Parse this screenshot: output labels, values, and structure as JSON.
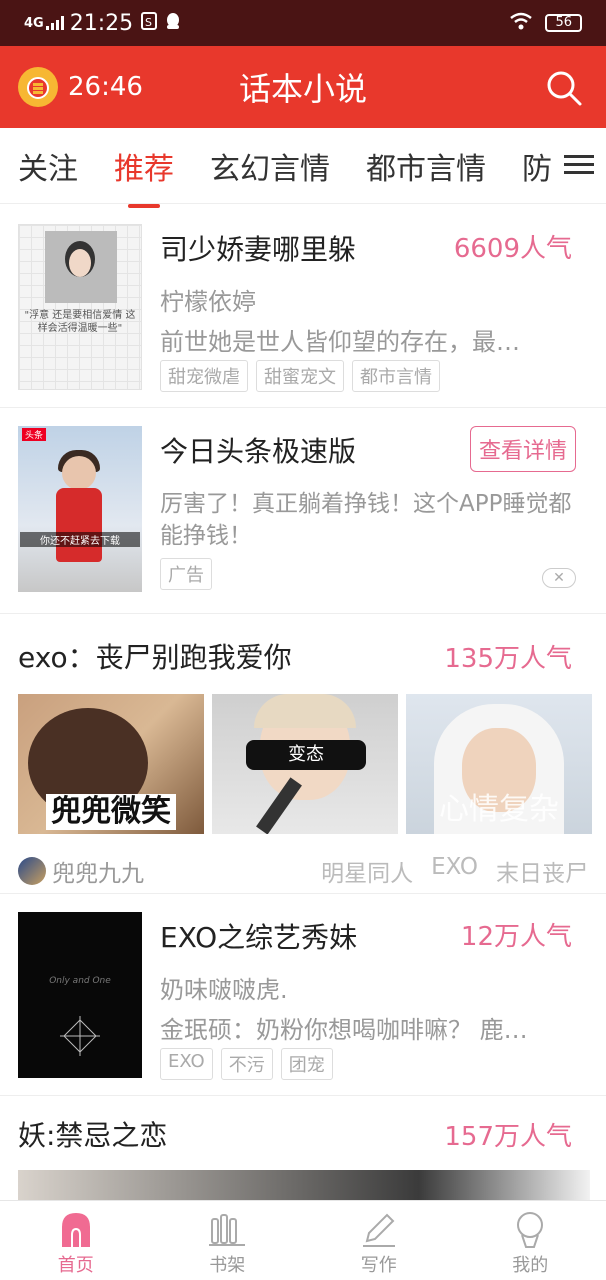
{
  "status_bar": {
    "network": "4G",
    "time": "21:25",
    "battery": "56"
  },
  "app_bar": {
    "timer": "26:46",
    "title": "话本小说"
  },
  "tabs": [
    {
      "label": "关注",
      "active": false
    },
    {
      "label": "推荐",
      "active": true
    },
    {
      "label": "玄幻言情",
      "active": false
    },
    {
      "label": "都市言情",
      "active": false
    },
    {
      "label": "防",
      "active": false
    }
  ],
  "feed": {
    "book1": {
      "title": "司少娇妻哪里躲",
      "popularity": "6609人气",
      "author": "柠檬依婷",
      "desc": "前世她是世人皆仰望的存在，最…",
      "tags": [
        "甜宠微虐",
        "甜蜜宠文",
        "都市言情"
      ],
      "cover_caption": "\"浮意 还是要相信爱情 这样会活得温暖一些\""
    },
    "ad": {
      "title": "今日头条极速版",
      "button": "查看详情",
      "desc": "厉害了！真正躺着挣钱！这个APP睡觉都能挣钱！",
      "tag": "广告",
      "cover_logo": "头条",
      "cover_subtitle": "你还不赶紧去下载",
      "close": "✕"
    },
    "book2": {
      "title": "exo：丧尸别跑我爱你",
      "popularity": "135万人气",
      "images": [
        "兜兜微笑",
        "变态",
        "心情复杂"
      ],
      "author": "兜兜九九",
      "tags": [
        "明星同人",
        "EXO",
        "末日丧尸"
      ]
    },
    "book3": {
      "title": "EXO之综艺秀妹",
      "popularity": "12万人气",
      "author": "奶味啵啵虎.",
      "desc": "金珉硕：奶粉你想喝咖啡嘛？ 鹿…",
      "tags": [
        "EXO",
        "不污",
        "团宠"
      ],
      "cover_text": "Only and One"
    },
    "book4": {
      "title": "妖:禁忌之恋",
      "popularity": "157万人气"
    }
  },
  "bottom_nav": [
    {
      "label": "首页",
      "icon": "home-icon",
      "active": true
    },
    {
      "label": "书架",
      "icon": "bookshelf-icon",
      "active": false
    },
    {
      "label": "写作",
      "icon": "pencil-icon",
      "active": false
    },
    {
      "label": "我的",
      "icon": "profile-icon",
      "active": false
    }
  ],
  "colors": {
    "primary": "#e8382c",
    "accent_pink": "#e66a90",
    "status_bar": "#4a1414"
  }
}
